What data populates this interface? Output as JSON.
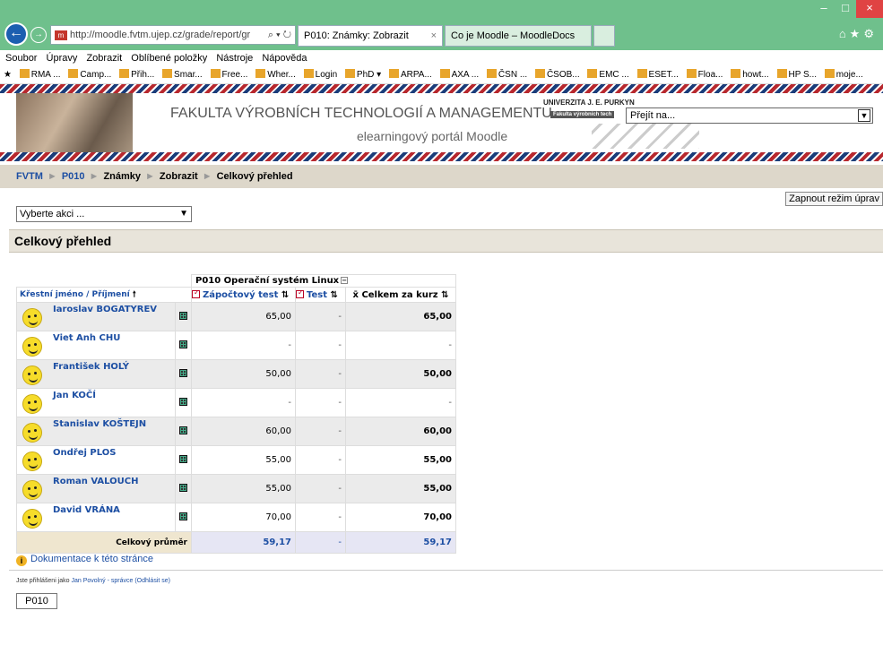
{
  "browser": {
    "address": "http://moodle.fvtm.ujep.cz/grade/report/gr",
    "tabs": [
      {
        "label": "P010: Známky: Zobrazit"
      },
      {
        "label": "Co je Moodle – MoodleDocs"
      }
    ],
    "menu": [
      "Soubor",
      "Úpravy",
      "Zobrazit",
      "Oblíbené položky",
      "Nástroje",
      "Nápověda"
    ],
    "favorites": [
      "RMA ...",
      "Camp...",
      "Přih...",
      "Smar...",
      "Free...",
      "Wher...",
      "Login",
      "PhD ▾",
      "ARPA...",
      "AXA ...",
      "ČSN ...",
      "ČSOB...",
      "EMC ...",
      "ESET...",
      "Floa...",
      "howt...",
      "HP S...",
      "moje..."
    ]
  },
  "header": {
    "title": "FAKULTA VÝROBNÍCH TECHNOLOGIÍ A MANAGEMENTU",
    "subtitle": "elearningový portál Moodle",
    "university": "UNIVERZITA J. E. PURKYN",
    "faculty": "Fakulta výrobních tech",
    "jump_placeholder": "Přejít na..."
  },
  "breadcrumb": [
    "FVTM",
    "P010",
    "Známky",
    "Zobrazit",
    "Celkový přehled"
  ],
  "edit_mode_button": "Zapnout režim úprav",
  "action_select": "Vyberte akci ...",
  "section_title": "Celkový přehled",
  "table": {
    "category": "P010 Operační systém Linux",
    "user_header_first": "Křestní jméno",
    "user_header_sep": " / ",
    "user_header_last": "Příjmení",
    "columns": [
      "Zápočtový test",
      "Test",
      "Celkem za kurz"
    ],
    "rows": [
      {
        "name": "Iaroslav BOGATYREV",
        "test1": "65,00",
        "test": "-",
        "total": "65,00"
      },
      {
        "name": "Viet Anh CHU",
        "test1": "-",
        "test": "-",
        "total": "-"
      },
      {
        "name": "František HOLÝ",
        "test1": "50,00",
        "test": "-",
        "total": "50,00"
      },
      {
        "name": "Jan KOČÍ",
        "test1": "-",
        "test": "-",
        "total": "-"
      },
      {
        "name": "Stanislav KOŠTEJN",
        "test1": "60,00",
        "test": "-",
        "total": "60,00"
      },
      {
        "name": "Ondřej PLOS",
        "test1": "55,00",
        "test": "-",
        "total": "55,00"
      },
      {
        "name": "Roman VALOUCH",
        "test1": "55,00",
        "test": "-",
        "total": "55,00"
      },
      {
        "name": "David VRÁNA",
        "test1": "70,00",
        "test": "-",
        "total": "70,00"
      }
    ],
    "average": {
      "label": "Celkový průměr",
      "test1": "59,17",
      "test": "-",
      "total": "59,17"
    }
  },
  "footer": {
    "doc_link": "Dokumentace k této stránce",
    "logged_as": "Jste přihlášeni jako",
    "user": "Jan Povolný - správce",
    "logout": "(Odhlásit se)",
    "course_button": "P010"
  }
}
